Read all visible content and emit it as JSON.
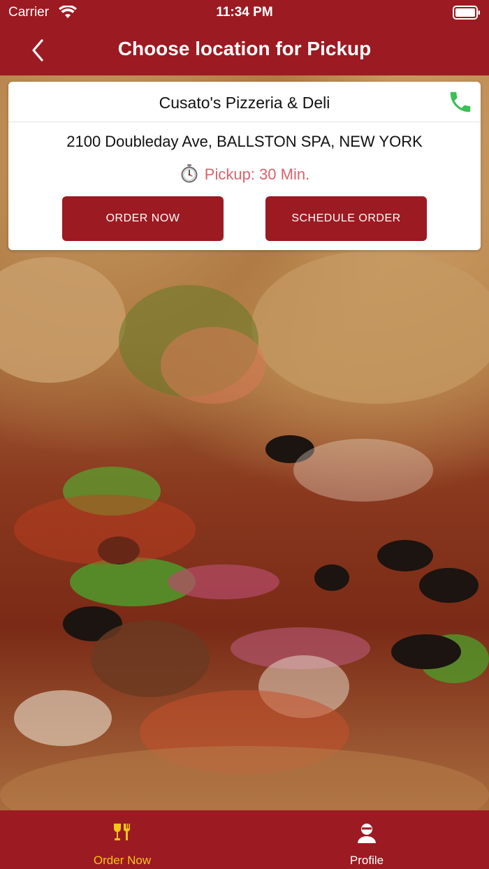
{
  "status_bar": {
    "carrier": "Carrier",
    "time": "11:34 PM"
  },
  "nav": {
    "title": "Choose location for Pickup",
    "back_icon": "chevron-left-icon"
  },
  "store": {
    "name": "Cusato's Pizzeria & Deli",
    "address": "2100 Doubleday Ave, BALLSTON SPA, NEW YORK",
    "pickup": "Pickup: 30 Min.",
    "order_now_label": "ORDER NOW",
    "schedule_label": "SCHEDULE ORDER"
  },
  "tabs": [
    {
      "label": "Order Now",
      "icon": "fork-glass-icon",
      "active": true
    },
    {
      "label": "Profile",
      "icon": "user-icon",
      "active": false
    }
  ],
  "colors": {
    "brand": "#9c1a22",
    "pickup_text": "#d9636a",
    "phone": "#3bbf57",
    "tab_active": "#f5c518",
    "tab_inactive": "#ffffff"
  }
}
